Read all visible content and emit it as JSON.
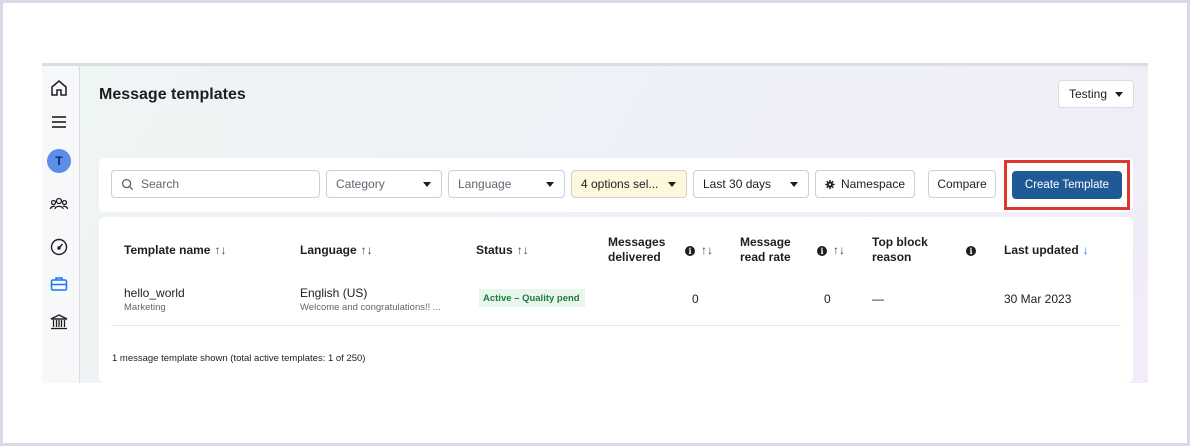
{
  "page": {
    "title": "Message templates",
    "account": "Testing"
  },
  "sidebar": {
    "items": [
      {
        "icon": "home-icon"
      },
      {
        "icon": "menu-icon"
      },
      {
        "icon": "avatar",
        "initial": "T"
      },
      {
        "icon": "people-icon"
      },
      {
        "icon": "speedometer-icon"
      },
      {
        "icon": "briefcase-icon",
        "active": true
      },
      {
        "icon": "bank-icon"
      }
    ]
  },
  "toolbar": {
    "search_placeholder": "Search",
    "category": "Category",
    "language": "Language",
    "status_filter": "4 options sel...",
    "date_range": "Last 30 days",
    "namespace": "Namespace",
    "compare": "Compare",
    "create": "Create Template"
  },
  "table": {
    "headers": {
      "name": "Template name",
      "language": "Language",
      "status": "Status",
      "delivered_1": "Messages",
      "delivered_2": "delivered",
      "readrate_1": "Message",
      "readrate_2": "read rate",
      "block_1": "Top block",
      "block_2": "reason",
      "updated": "Last updated"
    },
    "rows": [
      {
        "name": "hello_world",
        "category": "Marketing",
        "language": "English (US)",
        "preview": "Welcome and congratulations!! ...",
        "status": "Active – Quality pend",
        "delivered": "0",
        "read_rate": "0",
        "block_reason": "—",
        "updated": "30 Mar 2023"
      }
    ],
    "footer": "1 message template shown (total active templates: 1 of 250)"
  },
  "colors": {
    "primary_button": "#1f5a96",
    "highlight_border": "#d9392d",
    "status_active": "#1b7a3e",
    "avatar": "#5b8ee6"
  }
}
